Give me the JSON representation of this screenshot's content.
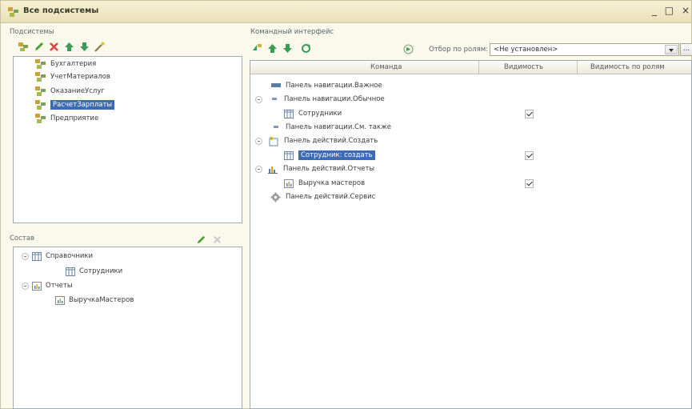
{
  "window": {
    "title": "Все подсистемы",
    "controls": [
      "_",
      "□",
      "×"
    ]
  },
  "left": {
    "subsystems_label": "Подсистемы",
    "subsystems": [
      {
        "label": "Бухгалтерия"
      },
      {
        "label": "УчетМатериалов"
      },
      {
        "label": "ОказаниеУслуг"
      },
      {
        "label": "РасчетЗарплаты",
        "selected": true
      },
      {
        "label": "Предприятие"
      }
    ],
    "composition_label": "Состав",
    "composition": {
      "ref_group": "Справочники",
      "ref_item": "Сотрудники",
      "rep_group": "Отчеты",
      "rep_item": "ВыручкаМастеров"
    }
  },
  "right": {
    "label": "Командный интерфейс",
    "role_filter_label": "Отбор по ролям:",
    "role_filter_value": "<Не установлен>",
    "role_filter_more": "...",
    "columns": [
      "Команда",
      "Видимость",
      "Видимость по ролям"
    ],
    "rows": [
      {
        "label": "Панель навигации.Важное",
        "checked": false
      },
      {
        "label": "Панель навигации.Обычное",
        "checked": false
      },
      {
        "label": "Сотрудники",
        "checked": true
      },
      {
        "label": "Панель навигации.См. также",
        "checked": false
      },
      {
        "label": "Панель действий.Создать",
        "checked": false
      },
      {
        "label": "Сотрудник: создать",
        "checked": true,
        "selected": true
      },
      {
        "label": "Панель действий.Отчеты",
        "checked": false
      },
      {
        "label": "Выручка мастеров",
        "checked": true
      },
      {
        "label": "Панель действий.Сервис",
        "checked": false
      }
    ]
  },
  "colors": {
    "selection": "#3d6bb3",
    "window_bg": "#fbf8ec",
    "titlebar": "#e9e0b8",
    "border": "#9eaab1"
  }
}
